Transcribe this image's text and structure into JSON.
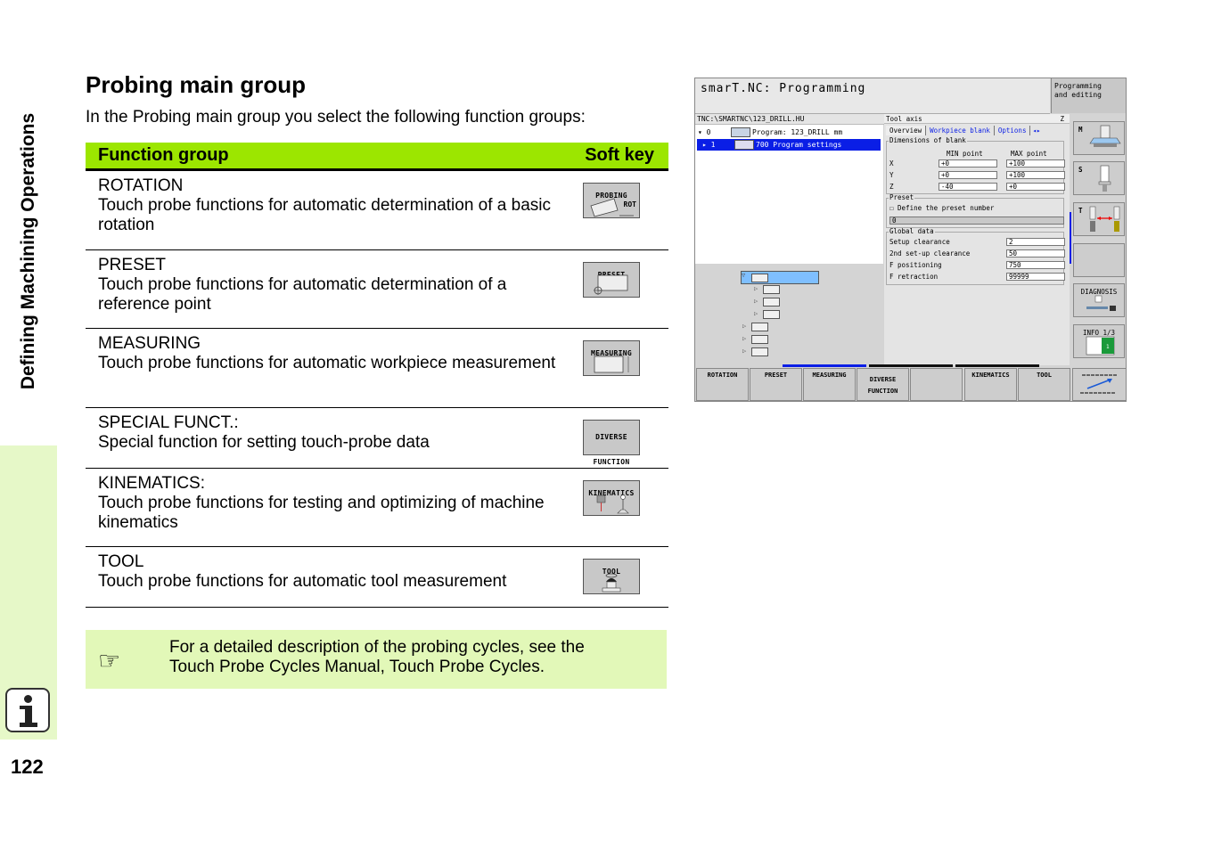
{
  "side": {
    "chapter_title": "Defining Machining Operations",
    "page_number": "122",
    "info_icon": "info-icon"
  },
  "page": {
    "title": "Probing main group",
    "intro": "In the Probing main group you select the following function groups:"
  },
  "table": {
    "header_function": "Function group",
    "header_softkey": "Soft key",
    "rows": [
      {
        "name": "ROTATION",
        "desc": "Touch probe functions for automatic determination of a basic rotation",
        "softkey_label": "PROBING",
        "softkey_sub": "ROT",
        "icon": "rotation-softkey-icon"
      },
      {
        "name": "PRESET",
        "desc": "Touch probe functions for automatic determination of a reference point",
        "softkey_label": "PRESET",
        "softkey_sub": "",
        "icon": "preset-softkey-icon"
      },
      {
        "name": "MEASURING",
        "desc": "Touch probe functions for automatic workpiece measurement",
        "softkey_label": "MEASURING",
        "softkey_sub": "",
        "icon": "measuring-softkey-icon"
      },
      {
        "name": "SPECIAL FUNCT.:",
        "desc": "Special function for setting touch-probe data",
        "softkey_label": "DIVERSE",
        "softkey_sub": "FUNCTION",
        "icon": "diverse-function-softkey-icon"
      },
      {
        "name": "KINEMATICS:",
        "desc": "Touch probe functions for testing and optimizing of machine kinematics",
        "softkey_label": "KINEMATICS",
        "softkey_sub": "",
        "icon": "kinematics-softkey-icon"
      },
      {
        "name": "TOOL",
        "desc": "Touch probe functions for automatic tool measurement",
        "softkey_label": "TOOL",
        "softkey_sub": "",
        "icon": "tool-softkey-icon"
      }
    ]
  },
  "note": {
    "icon": "pointing-hand-icon",
    "text_line1": "For a detailed description of the probing cycles, see the",
    "text_line2": "Touch Probe Cycles Manual, Touch Probe Cycles."
  },
  "cnc": {
    "title": "smarT.NC: Programming",
    "mode_line1": "Programming",
    "mode_line2": "and editing",
    "path": "TNC:\\SMARTNC\\123_DRILL.HU",
    "tree": [
      {
        "num": "▾ 0",
        "label": "Program: 123_DRILL mm",
        "selected": false
      },
      {
        "num": "▸ 1",
        "label": "700 Program settings",
        "selected": true
      }
    ],
    "form": {
      "header": "Tool axis",
      "header_value": "Z",
      "tabs": [
        "Overview",
        "Workpiece blank",
        "Options"
      ],
      "dims_legend": "Dimensions of blank",
      "min_label": "MIN point",
      "max_label": "MAX point",
      "axes": [
        {
          "axis": "X",
          "min": "+0",
          "max": "+100"
        },
        {
          "axis": "Y",
          "min": "+0",
          "max": "+100"
        },
        {
          "axis": "Z",
          "min": "-40",
          "max": "+0"
        }
      ],
      "preset_legend": "Preset",
      "preset_checkbox": "Define the preset number",
      "preset_value": "0",
      "global_legend": "Global data",
      "global": [
        {
          "label": "Setup clearance",
          "value": "2"
        },
        {
          "label": "2nd set-up clearance",
          "value": "50"
        },
        {
          "label": "F positioning",
          "value": "750"
        },
        {
          "label": "F retraction",
          "value": "99999"
        }
      ]
    },
    "right_keys": [
      {
        "key": "M",
        "label": "",
        "icon": "machine-table-icon"
      },
      {
        "key": "S",
        "label": "",
        "icon": "spindle-icon"
      },
      {
        "key": "T",
        "label": "",
        "icon": "tool-change-icon"
      },
      {
        "key": "",
        "label": "",
        "icon": ""
      },
      {
        "key": "",
        "label": "DIAGNOSIS",
        "icon": "diagnosis-icon"
      },
      {
        "key": "",
        "label": "INFO 1/3",
        "icon": "info-page-icon"
      }
    ],
    "bottom_keys": [
      {
        "line1": "ROTATION",
        "line2": ""
      },
      {
        "line1": "PRESET",
        "line2": ""
      },
      {
        "line1": "MEASURING",
        "line2": ""
      },
      {
        "line1": "DIVERSE",
        "line2": "FUNCTION"
      },
      {
        "line1": "",
        "line2": ""
      },
      {
        "line1": "KINEMATICS",
        "line2": ""
      },
      {
        "line1": "TOOL",
        "line2": ""
      },
      {
        "line1": "",
        "line2": ""
      }
    ]
  }
}
